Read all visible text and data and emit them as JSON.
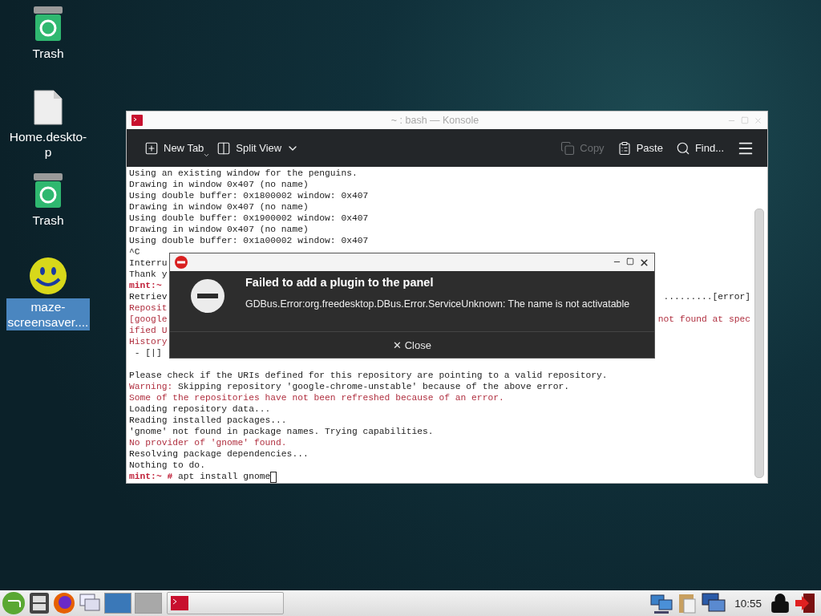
{
  "desktop_icons": [
    {
      "label": "Trash",
      "kind": "trash",
      "selected": false
    },
    {
      "label": "Home.deskto-p",
      "kind": "document",
      "selected": false
    },
    {
      "label": "Trash",
      "kind": "trash",
      "selected": false
    },
    {
      "label": "maze-screensaver....",
      "kind": "smiley",
      "selected": true
    }
  ],
  "window": {
    "title": "~ : bash — Konsole"
  },
  "toolbar": [
    {
      "label": "New Tab",
      "kind": "new-tab",
      "disabled": false
    },
    {
      "label": "Split View",
      "kind": "split-view",
      "disabled": false
    },
    {
      "label": "Copy",
      "kind": "copy",
      "disabled": true
    },
    {
      "label": "Paste",
      "kind": "paste",
      "disabled": false
    },
    {
      "label": "Find...",
      "kind": "find",
      "disabled": false
    }
  ],
  "terminal_lines": [
    {
      "parts": [
        {
          "text": "Using an existing window for the penguins.",
          "kind": "normal"
        }
      ]
    },
    {
      "parts": [
        {
          "text": "Drawing in window 0x407 (no name)",
          "kind": "normal"
        }
      ]
    },
    {
      "parts": [
        {
          "text": "Using double buffer: 0x1800002 window: 0x407",
          "kind": "normal"
        }
      ]
    },
    {
      "parts": [
        {
          "text": "Drawing in window 0x407 (no name)",
          "kind": "normal"
        }
      ]
    },
    {
      "parts": [
        {
          "text": "Using double buffer: 0x1900002 window: 0x407",
          "kind": "normal"
        }
      ]
    },
    {
      "parts": [
        {
          "text": "Drawing in window 0x407 (no name)",
          "kind": "normal"
        }
      ]
    },
    {
      "parts": [
        {
          "text": "Using double buffer: 0x1a00002 window: 0x407",
          "kind": "normal"
        }
      ]
    },
    {
      "parts": [
        {
          "text": "^C",
          "kind": "normal"
        }
      ]
    },
    {
      "parts": [
        {
          "text": "Interru",
          "kind": "normal"
        }
      ]
    },
    {
      "parts": [
        {
          "text": "Thank y",
          "kind": "normal"
        }
      ]
    },
    {
      "parts": [
        {
          "text": "mint:~",
          "kind": "prompt"
        }
      ]
    },
    {
      "parts": [
        {
          "text": "Retriev",
          "kind": "normal"
        }
      ],
      "tail": {
        "text": ".........[error]",
        "kind": "normal"
      }
    },
    {
      "parts": [
        {
          "text": "Reposit",
          "kind": "error"
        }
      ]
    },
    {
      "parts": [
        {
          "text": "[google",
          "kind": "error"
        }
      ],
      "tail": {
        "text": "not found at spec",
        "kind": "error"
      }
    },
    {
      "parts": [
        {
          "text": "ified U",
          "kind": "error"
        }
      ]
    },
    {
      "parts": [
        {
          "text": "History",
          "kind": "error"
        }
      ]
    },
    {
      "parts": [
        {
          "text": " - [|]",
          "kind": "normal"
        }
      ]
    },
    {
      "blank_before": true,
      "parts": [
        {
          "text": "Please check if the URIs defined for this repository are pointing to a valid repository.",
          "kind": "normal"
        }
      ]
    },
    {
      "parts": [
        {
          "text": "Warning:",
          "kind": "error"
        },
        {
          "text": " Skipping repository 'google-chrome-unstable' because of the above error.",
          "kind": "normal"
        }
      ]
    },
    {
      "parts": [
        {
          "text": "Some of the repositories have not been refreshed because of an error.",
          "kind": "error"
        }
      ]
    },
    {
      "parts": [
        {
          "text": "Loading repository data...",
          "kind": "normal"
        }
      ]
    },
    {
      "parts": [
        {
          "text": "Reading installed packages...",
          "kind": "normal"
        }
      ]
    },
    {
      "parts": [
        {
          "text": "'gnome' not found in package names. Trying capabilities.",
          "kind": "normal"
        }
      ]
    },
    {
      "parts": [
        {
          "text": "No provider of 'gnome' found.",
          "kind": "error"
        }
      ]
    },
    {
      "parts": [
        {
          "text": "Resolving package dependencies...",
          "kind": "normal"
        }
      ]
    },
    {
      "parts": [
        {
          "text": "Nothing to do.",
          "kind": "normal"
        }
      ]
    },
    {
      "parts": [
        {
          "text": "mint:~ #",
          "kind": "prompt"
        },
        {
          "text": " apt install gnome",
          "kind": "normal"
        }
      ],
      "cursor": true
    }
  ],
  "dialog": {
    "title": "Failed to add a plugin to the panel",
    "message": "GDBus.Error:org.freedesktop.DBus.Error.ServiceUnknown: The name is not activatable",
    "button_icon": "✕",
    "button": "Close"
  },
  "taskbar": {
    "workspaces": [
      {
        "selected": true
      },
      {
        "selected": false
      }
    ],
    "tasks": [
      {
        "kind": "terminal"
      }
    ],
    "clock": "10:55"
  }
}
